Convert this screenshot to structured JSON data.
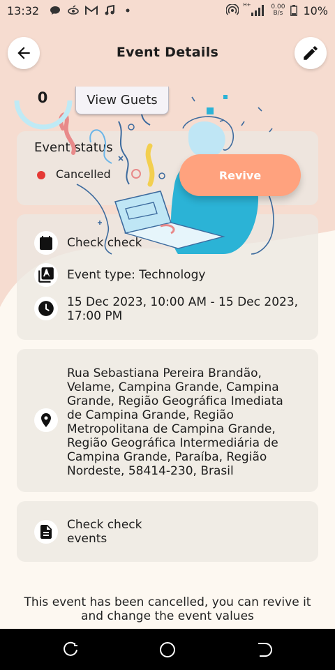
{
  "status_bar": {
    "time": "13:32",
    "net_speed_value": "0.00",
    "net_speed_unit": "B/s",
    "battery": "10%",
    "network_type": "H+",
    "left_icons": [
      "chat-bubble-icon",
      "antenna-icon",
      "gmail-icon",
      "music-note-icon",
      "dot-icon"
    ],
    "right_icons": [
      "hotspot-icon",
      "signal-icon",
      "battery-icon"
    ]
  },
  "app_bar": {
    "title": "Event Details",
    "back_icon": "arrow-left-icon",
    "edit_icon": "pencil-icon"
  },
  "guests": {
    "count": "0",
    "view_label": "View Guets"
  },
  "status": {
    "title": "Event status",
    "value": "Cancelled",
    "dot_color": "#e53935",
    "revive_label": "Revive"
  },
  "info": {
    "name": "Check check",
    "type": "Event type: Technology",
    "datetime_line1": "15 Dec 2023, 10:00 AM - 15 Dec 2023,",
    "datetime_line2": "17:00 PM"
  },
  "address": {
    "lines": [
      "Rua Sebastiana Pereira Brandão,",
      "Velame, Campina Grande, Campina",
      "Grande, Região Geográfica Imediata",
      "de Campina Grande, Região",
      "Metropolitana de Campina Grande,",
      "Região Geográfica Intermediária de",
      "Campina Grande, Paraíba, Região",
      "Nordeste, 58414-230, Brasil"
    ]
  },
  "description": {
    "line1": "Check check",
    "line2": "events"
  },
  "footer": {
    "line1": "This event has been cancelled, you can revive it",
    "line2": "and change the event values"
  },
  "colors": {
    "accent": "#ffa27e",
    "background_blob": "#f6dcd0",
    "page_bg": "#fdf8f1",
    "ring": "#bfeaf5"
  }
}
